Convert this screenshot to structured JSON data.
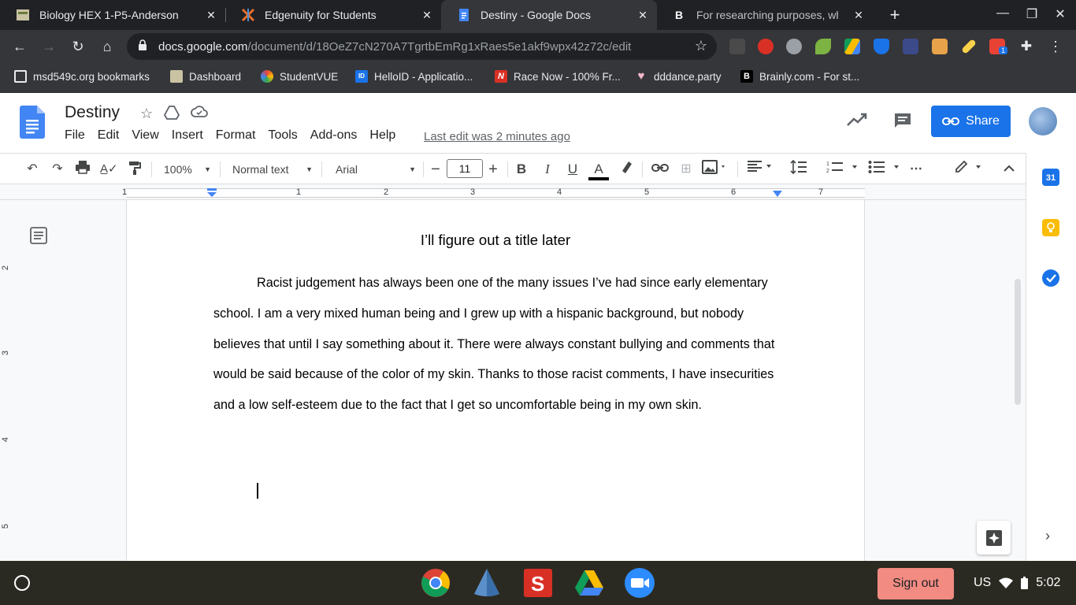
{
  "browser": {
    "tabs": [
      {
        "title": "Biology HEX 1-P5-Anderson",
        "active": false
      },
      {
        "title": "Edgenuity for Students",
        "active": false
      },
      {
        "title": "Destiny - Google Docs",
        "active": true
      },
      {
        "title": "For researching purposes, when",
        "active": false
      }
    ],
    "url_host": "docs.google.com",
    "url_path": "/document/d/18OeZ7cN270A7TgrtbEmRg1xRaes5e1akf9wpx42z72c/edit",
    "bookmarks": [
      "msd549c.org bookmarks",
      "Dashboard",
      "StudentVUE",
      "HelloID - Applicatio...",
      "Race Now - 100% Fr...",
      "dddance.party",
      "Brainly.com - For st..."
    ],
    "extension_badge": "1"
  },
  "docs": {
    "title": "Destiny",
    "menu": [
      "File",
      "Edit",
      "View",
      "Insert",
      "Format",
      "Tools",
      "Add-ons",
      "Help"
    ],
    "last_edit": "Last edit was 2 minutes ago",
    "share_label": "Share",
    "toolbar": {
      "zoom": "100%",
      "style": "Normal text",
      "font": "Arial",
      "font_size": "11"
    },
    "ruler_numbers": [
      "1",
      "1",
      "2",
      "3",
      "4",
      "5",
      "6",
      "7"
    ],
    "vruler_numbers": [
      "2",
      "3",
      "4",
      "5"
    ],
    "document": {
      "heading": "I’ll figure out a title later",
      "paragraph": "Racist judgement has always been one of the many issues I’ve had since early elementary school. I am a very mixed human being and I grew up with a hispanic background, but nobody believes that until I say something about it. There were always constant bullying and comments that would be said because of the color of my skin. Thanks to those racist comments, I have insecurities and a low self-esteem due to the fact that I get so uncomfortable being in my own skin."
    },
    "calendar_day": "31"
  },
  "shelf": {
    "signout_label": "Sign out",
    "locale": "US",
    "time": "5:02"
  },
  "colors": {
    "docs_blue": "#1a73e8",
    "tab_dark": "#202124",
    "toolbar_dark": "#35363a",
    "signout": "#f28b82"
  }
}
